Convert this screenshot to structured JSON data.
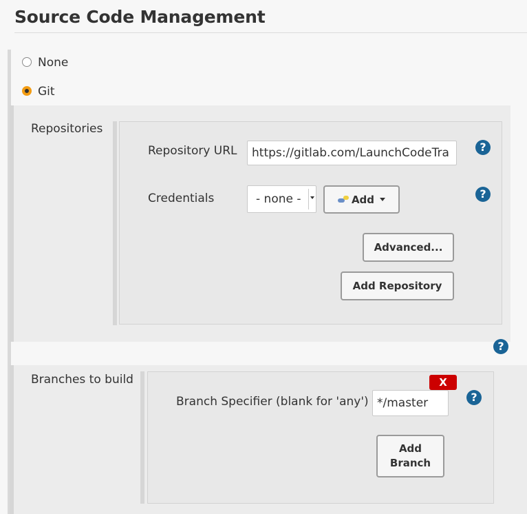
{
  "section": {
    "title": "Source Code Management"
  },
  "scm_options": [
    {
      "label": "None",
      "checked": false
    },
    {
      "label": "Git",
      "checked": true
    }
  ],
  "repositories": {
    "label": "Repositories",
    "url_label": "Repository URL",
    "url_value": "https://gitlab.com/LaunchCodeTra",
    "credentials_label": "Credentials",
    "credentials_value": "- none -",
    "add_label": "Add",
    "advanced_label": "Advanced...",
    "add_repository_label": "Add Repository"
  },
  "branches": {
    "label": "Branches to build",
    "specifier_label": "Branch Specifier (blank for 'any')",
    "specifier_value": "*/master",
    "delete_label": "X",
    "add_branch_label": "Add Branch"
  },
  "help_label": "?",
  "colors": {
    "accent_radio": "#f39c12",
    "help_icon": "#1a6496",
    "delete_button": "#cc0000"
  }
}
